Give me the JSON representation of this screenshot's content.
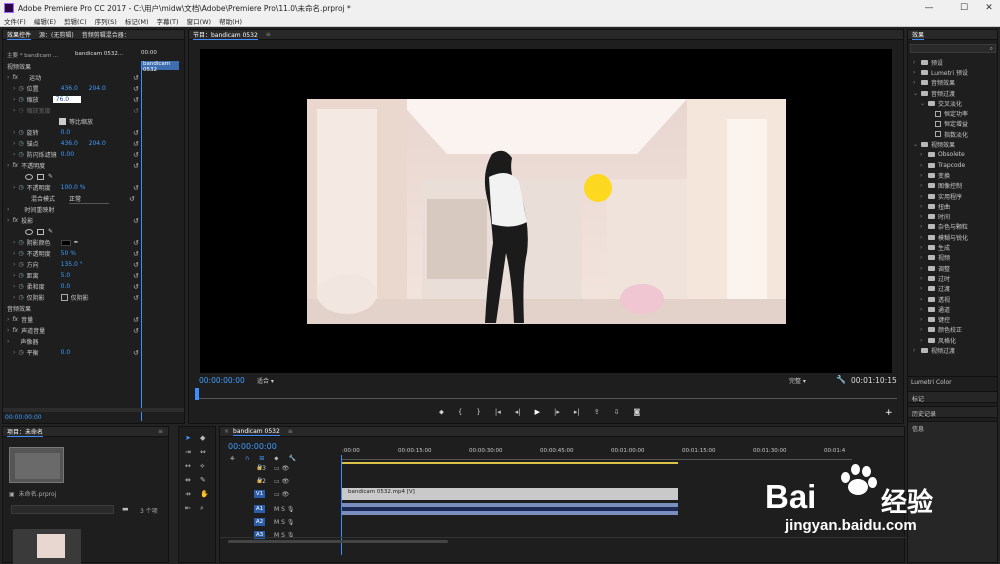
{
  "window": {
    "title": "Adobe Premiere Pro CC 2017 - C:\\用户\\midw\\文档\\Adobe\\Premiere Pro\\11.0\\未命名.prproj *"
  },
  "menu": [
    "文件(F)",
    "编辑(E)",
    "剪辑(C)",
    "序列(S)",
    "标记(M)",
    "字幕(T)",
    "窗口(W)",
    "帮助(H)"
  ],
  "effect_controls": {
    "tabs": [
      "效果控件",
      "源：(无剪辑)",
      "音频剪辑混合器："
    ],
    "master": "主要 * bandicam ...",
    "seq": "bandicam 0532...",
    "clip_label": "bandicam 0532",
    "ruler": "00:00",
    "video_effects": "视频效果",
    "motion": "运动",
    "position": {
      "label": "位置",
      "x": "436.0",
      "y": "204.0"
    },
    "scale": {
      "label": "缩放",
      "value": "76.0"
    },
    "scale_width": "缩放宽度",
    "uniform": "等比缩放",
    "rotation": {
      "label": "旋转",
      "value": "0.0"
    },
    "anchor": {
      "label": "锚点",
      "x": "436.0",
      "y": "204.0"
    },
    "antiflicker": {
      "label": "防闪烁滤镜",
      "value": "0.00"
    },
    "opacity_group": "不透明度",
    "opacity": {
      "label": "不透明度",
      "value": "100.0 %"
    },
    "blend": {
      "label": "混合模式",
      "value": "正常"
    },
    "time_remap": "时间重映射",
    "shadow": "投影",
    "shadow_color": "阴影颜色",
    "shadow_opacity": {
      "label": "不透明度",
      "value": "50 %"
    },
    "direction": {
      "label": "方向",
      "value": "135.0 °"
    },
    "distance": {
      "label": "距离",
      "value": "5.0"
    },
    "softness": {
      "label": "柔和度",
      "value": "0.0"
    },
    "shadow_only": {
      "label": "仅阴影",
      "check": "仅阴影"
    },
    "audio_effects": "音频效果",
    "volume": "音量",
    "channel_volume": "声道音量",
    "panner": "声像器",
    "balance": {
      "label": "平衡",
      "value": "0.0"
    },
    "timecode": "00:00:00:00"
  },
  "program": {
    "tab": "节目：bandicam 0532",
    "timecode": "00:00:00:00",
    "fit": "适合",
    "quality": "完整",
    "duration": "00:01:10:15"
  },
  "project": {
    "tab": "项目：未命名",
    "name": "未命名.prproj",
    "count": "3 个项"
  },
  "timeline": {
    "tab": "bandicam 0532",
    "timecode": "00:00:00:00",
    "ruler": [
      ":00:00",
      "00:00:15:00",
      "00:00:30:00",
      "00:00:45:00",
      "00:01:00:00",
      "00:01:15:00",
      "00:01:30:00",
      "00:01:4"
    ],
    "tracks_v": [
      "V3",
      "V2",
      "V1"
    ],
    "tracks_a": [
      "A1",
      "A2",
      "A3"
    ],
    "track_m": "M",
    "track_s": "S",
    "clip": "bandicam 0532.mp4 [V]"
  },
  "effects_panel": {
    "tab": "效果",
    "items": [
      {
        "t": "预设",
        "lvl": 0,
        "open": false
      },
      {
        "t": "Lumetri 预设",
        "lvl": 0,
        "open": false
      },
      {
        "t": "音频效果",
        "lvl": 0,
        "open": false
      },
      {
        "t": "音频过渡",
        "lvl": 0,
        "open": true
      },
      {
        "t": "交叉淡化",
        "lvl": 1,
        "open": true
      },
      {
        "t": "恒定功率",
        "lvl": 2,
        "preset": true
      },
      {
        "t": "恒定增益",
        "lvl": 2,
        "preset": true
      },
      {
        "t": "指数淡化",
        "lvl": 2,
        "preset": true
      },
      {
        "t": "视频效果",
        "lvl": 0,
        "open": true
      },
      {
        "t": "Obsolete",
        "lvl": 1,
        "open": false
      },
      {
        "t": "Trapcode",
        "lvl": 1,
        "open": false
      },
      {
        "t": "变换",
        "lvl": 1,
        "open": false
      },
      {
        "t": "图像控制",
        "lvl": 1,
        "open": false
      },
      {
        "t": "实用程序",
        "lvl": 1,
        "open": false
      },
      {
        "t": "扭曲",
        "lvl": 1,
        "open": false
      },
      {
        "t": "时间",
        "lvl": 1,
        "open": false
      },
      {
        "t": "杂色与颗粒",
        "lvl": 1,
        "open": false
      },
      {
        "t": "模糊与锐化",
        "lvl": 1,
        "open": false
      },
      {
        "t": "生成",
        "lvl": 1,
        "open": false
      },
      {
        "t": "视频",
        "lvl": 1,
        "open": false
      },
      {
        "t": "调整",
        "lvl": 1,
        "open": false
      },
      {
        "t": "过时",
        "lvl": 1,
        "open": false
      },
      {
        "t": "过渡",
        "lvl": 1,
        "open": false
      },
      {
        "t": "透视",
        "lvl": 1,
        "open": false
      },
      {
        "t": "通道",
        "lvl": 1,
        "open": false
      },
      {
        "t": "键控",
        "lvl": 1,
        "open": false
      },
      {
        "t": "颜色校正",
        "lvl": 1,
        "open": false
      },
      {
        "t": "风格化",
        "lvl": 1,
        "open": false
      },
      {
        "t": "视频过渡",
        "lvl": 0,
        "open": false
      }
    ],
    "sections": [
      "Lumetri Color",
      "标记",
      "历史记录",
      "信息"
    ]
  },
  "watermark": {
    "brand": "Bai",
    "brand2": "经验",
    "url": "jingyan.baidu.com"
  },
  "colors": {
    "accent": "#3f9bff",
    "clip_video": "#c9c9c9",
    "clip_audio": "#7b8fbf",
    "track_active": "#2b5ea8"
  }
}
